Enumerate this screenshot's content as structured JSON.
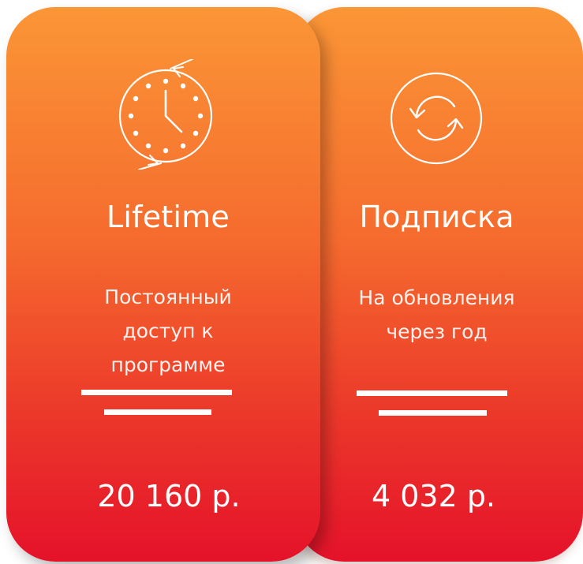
{
  "plans": [
    {
      "icon": "clock-icon",
      "title": "Lifetime",
      "description_line1": "Постоянный",
      "description_line2": "доступ к",
      "description_line3": "программе",
      "price": "20 160 р."
    },
    {
      "icon": "refresh-icon",
      "title": "Подписка",
      "description_line1": "На обновления",
      "description_line2": "через год",
      "price": "4 032 р."
    }
  ],
  "colors": {
    "gradient_top": "#fb9636",
    "gradient_bottom": "#e5122a",
    "foreground": "#ffffff"
  }
}
